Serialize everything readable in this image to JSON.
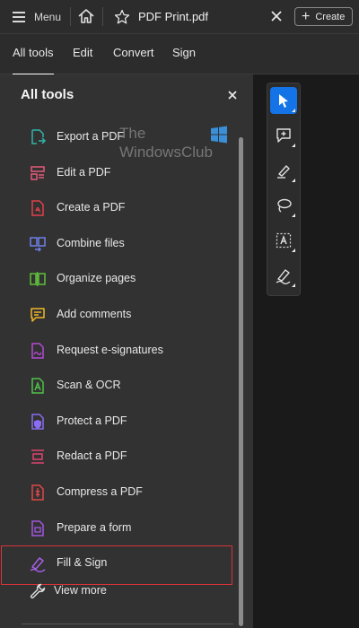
{
  "topbar": {
    "menu_label": "Menu",
    "tab_title": "PDF Print.pdf",
    "create_label": "Create"
  },
  "nav_tabs": [
    {
      "label": "All tools",
      "active": true
    },
    {
      "label": "Edit",
      "active": false
    },
    {
      "label": "Convert",
      "active": false
    },
    {
      "label": "Sign",
      "active": false
    }
  ],
  "panel": {
    "title": "All tools",
    "tools": [
      {
        "label": "Export a PDF",
        "icon": "export-pdf-icon",
        "color": "#2fb5a8"
      },
      {
        "label": "Edit a PDF",
        "icon": "edit-pdf-icon",
        "color": "#e45a7a"
      },
      {
        "label": "Create a PDF",
        "icon": "create-pdf-icon",
        "color": "#e0414a"
      },
      {
        "label": "Combine files",
        "icon": "combine-files-icon",
        "color": "#6f7fe8"
      },
      {
        "label": "Organize pages",
        "icon": "organize-pages-icon",
        "color": "#5fbf3a"
      },
      {
        "label": "Add comments",
        "icon": "add-comments-icon",
        "color": "#f0b82a"
      },
      {
        "label": "Request e-signatures",
        "icon": "request-esignatures-icon",
        "color": "#b54ad6"
      },
      {
        "label": "Scan & OCR",
        "icon": "scan-ocr-icon",
        "color": "#4fc24a"
      },
      {
        "label": "Protect a PDF",
        "icon": "protect-pdf-icon",
        "color": "#8a6cf0"
      },
      {
        "label": "Redact a PDF",
        "icon": "redact-pdf-icon",
        "color": "#e0446e"
      },
      {
        "label": "Compress a PDF",
        "icon": "compress-pdf-icon",
        "color": "#e04848"
      },
      {
        "label": "Prepare a form",
        "icon": "prepare-form-icon",
        "color": "#a258e0"
      },
      {
        "label": "Fill & Sign",
        "icon": "fill-sign-icon",
        "color": "#a660e6",
        "selected": true
      }
    ],
    "view_more_label": "View more"
  },
  "watermark": {
    "line1": "The",
    "line2": "WindowsClub"
  },
  "quick_tools": [
    {
      "icon": "select-cursor-icon",
      "active": true
    },
    {
      "icon": "add-comment-icon",
      "active": false
    },
    {
      "icon": "highlight-pen-icon",
      "active": false
    },
    {
      "icon": "lasso-draw-icon",
      "active": false
    },
    {
      "icon": "text-select-icon",
      "active": false
    },
    {
      "icon": "sign-pen-icon",
      "active": false
    }
  ],
  "colors": {
    "accent": "#1473e6",
    "selection_border": "#d6333a"
  }
}
